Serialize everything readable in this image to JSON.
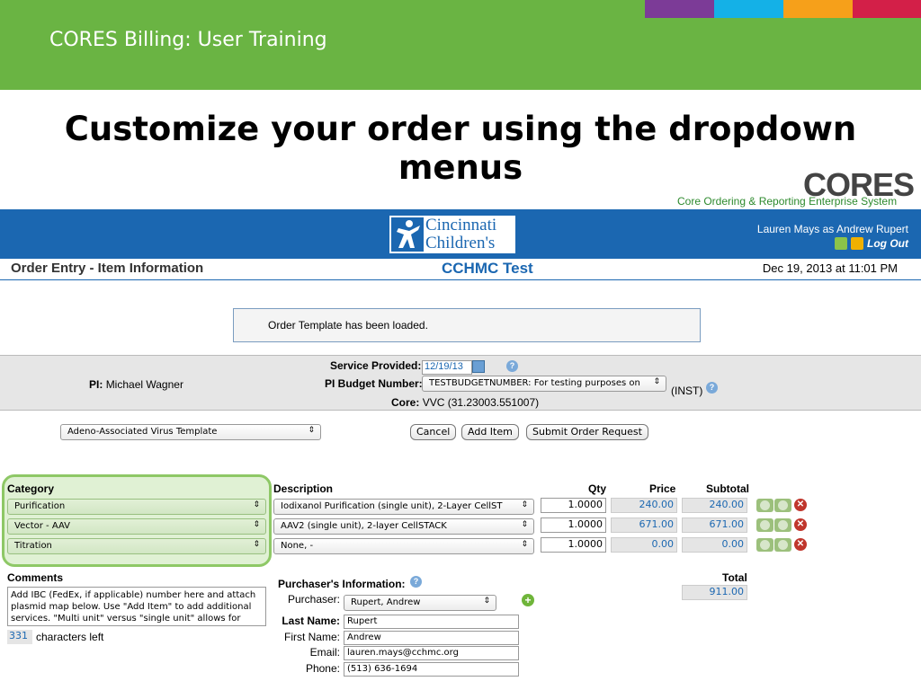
{
  "slide": {
    "title": "CORES Billing: User Training",
    "heading": "Customize your order using the dropdown menus",
    "strip_colors": [
      "#7c3b97",
      "#14b1e7",
      "#f6a01a",
      "#d31f48"
    ]
  },
  "logo": {
    "cores": "CORES",
    "tagline": "Core Ordering & Reporting Enterprise System",
    "cincinnati_line1": "Cincinnati",
    "cincinnati_line2": "Children's"
  },
  "header": {
    "user": "Lauren Mays as Andrew Rupert",
    "logout": "Log Out",
    "page_name": "Order Entry - Item Information",
    "org": "CCHMC Test",
    "date": "Dec 19, 2013 at 11:01 PM"
  },
  "message": "Order Template has been loaded.",
  "info": {
    "pi_label": "PI:",
    "pi_value": "Michael Wagner",
    "service_label": "Service Provided:",
    "service_date": "12/19/13",
    "budget_label": "PI Budget Number:",
    "budget_value": "TESTBUDGETNUMBER: For testing purposes on",
    "budget_suffix": "(INST)",
    "core_label": "Core:",
    "core_value": "VVC (31.23003.551007)"
  },
  "template_select": "Adeno-Associated Virus Template",
  "buttons": {
    "cancel": "Cancel",
    "add_item": "Add Item",
    "submit": "Submit Order Request"
  },
  "table": {
    "headers": {
      "category": "Category",
      "description": "Description",
      "qty": "Qty",
      "price": "Price",
      "subtotal": "Subtotal"
    },
    "rows": [
      {
        "category": "Purification",
        "description": "Iodixanol Purification (single unit), 2-Layer CellST",
        "qty": "1.0000",
        "price": "240.00",
        "subtotal": "240.00"
      },
      {
        "category": "Vector - AAV",
        "description": "AAV2 (single unit), 2-layer CellSTACK",
        "qty": "1.0000",
        "price": "671.00",
        "subtotal": "671.00"
      },
      {
        "category": "Titration",
        "description": "None, -",
        "qty": "1.0000",
        "price": "0.00",
        "subtotal": "0.00"
      }
    ],
    "total_label": "Total",
    "total": "911.00"
  },
  "comments": {
    "label": "Comments",
    "text": "Add IBC (FedEx, if applicable) number here and attach plasmid map below. Use \"Add Item\" to add additional services. \"Multi unit\" versus \"single unit\" allows for",
    "count": "331",
    "count_label": "characters left"
  },
  "purchaser": {
    "heading": "Purchaser's Information:",
    "purchaser_label": "Purchaser:",
    "purchaser_value": "Rupert, Andrew",
    "last_label": "Last Name:",
    "last_value": "Rupert",
    "first_label": "First Name:",
    "first_value": "Andrew",
    "email_label": "Email:",
    "email_value": "lauren.mays@cchmc.org",
    "phone_label": "Phone:",
    "phone_value": "(513) 636-1694"
  }
}
